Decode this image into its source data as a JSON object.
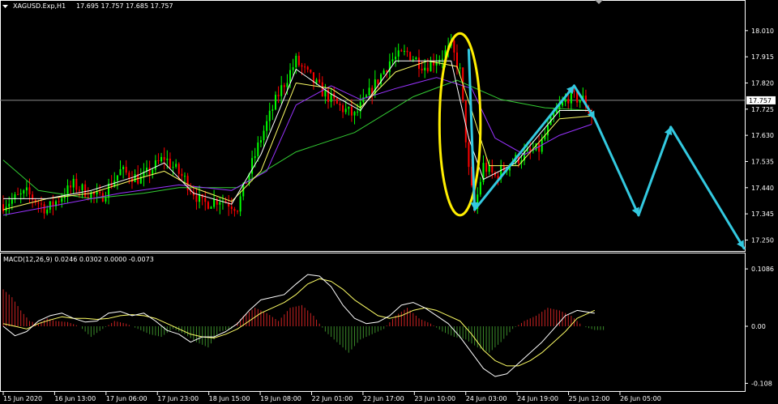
{
  "header": {
    "symbol_label": "XAGUSD.Exp,H1",
    "ohlc_label": "17.695 17.757 17.685 17.757"
  },
  "macd_header": {
    "label": "MACD(12,26,9) 0.0246 0.0302 0.0000 -0.0073"
  },
  "colors": {
    "background": "#000000",
    "bull_candle": "#00ff00",
    "bear_candle": "#ff0000",
    "ma_fast": "#ffffff",
    "ma_mid": "#ffff66",
    "ma_slow": "#9933ff",
    "ma_long": "#33cc33",
    "price_line": "#8c8c8c",
    "annotation_arrow": "#33c9e0",
    "annotation_ellipse": "#ffee00",
    "macd_positive": "#cc2222",
    "macd_negative": "#3a8a2a",
    "macd_line": "#ffffff",
    "signal_line": "#ffff66"
  },
  "chart_data": [
    {
      "type": "candlestick",
      "panel": "price",
      "title": "XAGUSD.Exp,H1",
      "y_ticks": [
        "18.010",
        "17.915",
        "17.820",
        "17.725",
        "17.630",
        "17.535",
        "17.440",
        "17.345",
        "17.250"
      ],
      "current_price_label": "17.757",
      "current_price": 17.757,
      "ylim": [
        17.222,
        18.08
      ],
      "x_tick_labels": [
        "15 Jun 2020",
        "16 Jun 13:00",
        "17 Jun 06:00",
        "17 Jun 23:00",
        "18 Jun 15:00",
        "19 Jun 08:00",
        "22 Jun 01:00",
        "22 Jun 17:00",
        "23 Jun 10:00",
        "24 Jun 03:00",
        "24 Jun 19:00",
        "25 Jun 12:00",
        "26 Jun 05:00"
      ],
      "price_path": [
        [
          0,
          17.38
        ],
        [
          8,
          17.42
        ],
        [
          15,
          17.36
        ],
        [
          24,
          17.45
        ],
        [
          33,
          17.4
        ],
        [
          40,
          17.5
        ],
        [
          47,
          17.47
        ],
        [
          55,
          17.55
        ],
        [
          62,
          17.47
        ],
        [
          68,
          17.38
        ],
        [
          74,
          17.4
        ],
        [
          80,
          17.37
        ],
        [
          88,
          17.62
        ],
        [
          94,
          17.78
        ],
        [
          100,
          17.9
        ],
        [
          108,
          17.8
        ],
        [
          114,
          17.74
        ],
        [
          120,
          17.7
        ],
        [
          125,
          17.78
        ],
        [
          132,
          17.9
        ],
        [
          138,
          17.93
        ],
        [
          144,
          17.88
        ],
        [
          150,
          17.92
        ],
        [
          153,
          17.95
        ],
        [
          156,
          17.86
        ],
        [
          159,
          17.5
        ],
        [
          161,
          17.36
        ],
        [
          164,
          17.52
        ],
        [
          168,
          17.48
        ],
        [
          173,
          17.53
        ],
        [
          178,
          17.56
        ],
        [
          183,
          17.58
        ],
        [
          188,
          17.7
        ],
        [
          193,
          17.77
        ],
        [
          198,
          17.76
        ],
        [
          201,
          17.7
        ]
      ],
      "ma_fast_path": [
        [
          0,
          17.4
        ],
        [
          15,
          17.4
        ],
        [
          30,
          17.43
        ],
        [
          45,
          17.48
        ],
        [
          55,
          17.53
        ],
        [
          65,
          17.42
        ],
        [
          78,
          17.38
        ],
        [
          88,
          17.56
        ],
        [
          100,
          17.87
        ],
        [
          112,
          17.78
        ],
        [
          122,
          17.72
        ],
        [
          134,
          17.9
        ],
        [
          145,
          17.9
        ],
        [
          153,
          17.9
        ],
        [
          159,
          17.62
        ],
        [
          164,
          17.47
        ],
        [
          175,
          17.53
        ],
        [
          190,
          17.72
        ],
        [
          201,
          17.72
        ]
      ],
      "ma_mid_path": [
        [
          0,
          17.36
        ],
        [
          15,
          17.4
        ],
        [
          30,
          17.42
        ],
        [
          45,
          17.47
        ],
        [
          55,
          17.5
        ],
        [
          65,
          17.44
        ],
        [
          78,
          17.39
        ],
        [
          88,
          17.5
        ],
        [
          100,
          17.82
        ],
        [
          112,
          17.8
        ],
        [
          122,
          17.73
        ],
        [
          134,
          17.86
        ],
        [
          145,
          17.9
        ],
        [
          155,
          17.88
        ],
        [
          160,
          17.72
        ],
        [
          166,
          17.52
        ],
        [
          176,
          17.52
        ],
        [
          190,
          17.69
        ],
        [
          201,
          17.7
        ]
      ],
      "ma_slow_path": [
        [
          0,
          17.34
        ],
        [
          20,
          17.38
        ],
        [
          40,
          17.42
        ],
        [
          60,
          17.45
        ],
        [
          78,
          17.43
        ],
        [
          90,
          17.5
        ],
        [
          100,
          17.74
        ],
        [
          112,
          17.81
        ],
        [
          122,
          17.76
        ],
        [
          134,
          17.8
        ],
        [
          148,
          17.84
        ],
        [
          160,
          17.8
        ],
        [
          168,
          17.62
        ],
        [
          178,
          17.56
        ],
        [
          190,
          17.63
        ],
        [
          201,
          17.67
        ]
      ],
      "ma_long_path": [
        [
          0,
          17.54
        ],
        [
          12,
          17.43
        ],
        [
          30,
          17.4
        ],
        [
          48,
          17.42
        ],
        [
          60,
          17.44
        ],
        [
          80,
          17.44
        ],
        [
          100,
          17.57
        ],
        [
          120,
          17.64
        ],
        [
          140,
          17.77
        ],
        [
          155,
          17.83
        ],
        [
          170,
          17.76
        ],
        [
          185,
          17.73
        ],
        [
          201,
          17.72
        ]
      ],
      "annotations": {
        "ellipse": {
          "x_center": 156,
          "y_center": 17.67,
          "x_radius": 7,
          "y_radius": 0.33
        },
        "arrows": [
          [
            [
              159,
              17.94
            ],
            [
              161,
              17.36
            ]
          ],
          [
            [
              161,
              17.36
            ],
            [
              195,
              17.81
            ]
          ],
          [
            [
              195,
              17.81
            ],
            [
              202,
              17.69
            ]
          ],
          [
            [
              202,
              17.69
            ],
            [
              217,
              17.34
            ]
          ],
          [
            [
              217,
              17.34
            ],
            [
              228,
              17.66
            ]
          ],
          [
            [
              228,
              17.66
            ],
            [
              253,
              17.22
            ]
          ]
        ]
      }
    },
    {
      "type": "macd",
      "panel": "indicator",
      "title": "MACD(12,26,9)",
      "values_label": "0.0246 0.0302 0.0000 -0.0073",
      "y_ticks": [
        "0.1086",
        "0.00",
        "-0.108"
      ],
      "ylim": [
        -0.118,
        0.118
      ],
      "histogram": [
        [
          0,
          0.07
        ],
        [
          3,
          0.055
        ],
        [
          6,
          0.03
        ],
        [
          9,
          0.01
        ],
        [
          12,
          0.005
        ],
        [
          15,
          0.015
        ],
        [
          18,
          0.01
        ],
        [
          22,
          0.008
        ],
        [
          26,
          0.0
        ],
        [
          30,
          -0.02
        ],
        [
          34,
          -0.005
        ],
        [
          38,
          0.01
        ],
        [
          42,
          0.005
        ],
        [
          46,
          -0.005
        ],
        [
          50,
          -0.015
        ],
        [
          54,
          -0.02
        ],
        [
          58,
          -0.005
        ],
        [
          62,
          -0.015
        ],
        [
          66,
          -0.03
        ],
        [
          70,
          -0.04
        ],
        [
          74,
          -0.01
        ],
        [
          78,
          -0.005
        ],
        [
          82,
          0.02
        ],
        [
          86,
          0.035
        ],
        [
          90,
          0.025
        ],
        [
          94,
          0.01
        ],
        [
          98,
          0.035
        ],
        [
          102,
          0.04
        ],
        [
          106,
          0.02
        ],
        [
          110,
          -0.01
        ],
        [
          114,
          -0.03
        ],
        [
          118,
          -0.05
        ],
        [
          122,
          -0.025
        ],
        [
          126,
          -0.015
        ],
        [
          130,
          -0.005
        ],
        [
          134,
          0.02
        ],
        [
          138,
          0.035
        ],
        [
          142,
          0.015
        ],
        [
          146,
          0.005
        ],
        [
          150,
          -0.01
        ],
        [
          154,
          -0.02
        ],
        [
          158,
          -0.025
        ],
        [
          162,
          -0.04
        ],
        [
          166,
          -0.05
        ],
        [
          170,
          -0.03
        ],
        [
          174,
          -0.005
        ],
        [
          178,
          0.01
        ],
        [
          182,
          0.02
        ],
        [
          186,
          0.035
        ],
        [
          190,
          0.03
        ],
        [
          194,
          0.02
        ],
        [
          198,
          0.0
        ],
        [
          202,
          -0.007
        ]
      ],
      "macd_line": [
        [
          0,
          0.0
        ],
        [
          4,
          -0.018
        ],
        [
          8,
          -0.01
        ],
        [
          12,
          0.01
        ],
        [
          16,
          0.02
        ],
        [
          20,
          0.025
        ],
        [
          24,
          0.015
        ],
        [
          28,
          0.008
        ],
        [
          32,
          0.01
        ],
        [
          36,
          0.025
        ],
        [
          40,
          0.028
        ],
        [
          44,
          0.02
        ],
        [
          48,
          0.025
        ],
        [
          52,
          0.01
        ],
        [
          56,
          -0.008
        ],
        [
          60,
          -0.015
        ],
        [
          64,
          -0.03
        ],
        [
          68,
          -0.02
        ],
        [
          72,
          -0.02
        ],
        [
          76,
          -0.01
        ],
        [
          80,
          0.005
        ],
        [
          84,
          0.03
        ],
        [
          88,
          0.05
        ],
        [
          92,
          0.055
        ],
        [
          96,
          0.06
        ],
        [
          100,
          0.08
        ],
        [
          104,
          0.098
        ],
        [
          108,
          0.095
        ],
        [
          112,
          0.075
        ],
        [
          116,
          0.04
        ],
        [
          120,
          0.015
        ],
        [
          124,
          0.005
        ],
        [
          128,
          0.008
        ],
        [
          132,
          0.02
        ],
        [
          136,
          0.04
        ],
        [
          140,
          0.045
        ],
        [
          144,
          0.035
        ],
        [
          148,
          0.02
        ],
        [
          152,
          0.005
        ],
        [
          156,
          -0.02
        ],
        [
          160,
          -0.05
        ],
        [
          164,
          -0.08
        ],
        [
          168,
          -0.095
        ],
        [
          172,
          -0.09
        ],
        [
          176,
          -0.07
        ],
        [
          180,
          -0.05
        ],
        [
          184,
          -0.03
        ],
        [
          188,
          -0.005
        ],
        [
          192,
          0.02
        ],
        [
          196,
          0.03
        ],
        [
          202,
          0.0246
        ]
      ],
      "signal_line": [
        [
          0,
          0.005
        ],
        [
          4,
          0.0
        ],
        [
          8,
          -0.005
        ],
        [
          12,
          0.005
        ],
        [
          16,
          0.012
        ],
        [
          20,
          0.018
        ],
        [
          24,
          0.015
        ],
        [
          28,
          0.015
        ],
        [
          32,
          0.013
        ],
        [
          36,
          0.015
        ],
        [
          40,
          0.02
        ],
        [
          44,
          0.022
        ],
        [
          48,
          0.02
        ],
        [
          52,
          0.015
        ],
        [
          56,
          0.005
        ],
        [
          60,
          -0.005
        ],
        [
          64,
          -0.015
        ],
        [
          68,
          -0.02
        ],
        [
          72,
          -0.022
        ],
        [
          76,
          -0.015
        ],
        [
          80,
          -0.005
        ],
        [
          84,
          0.01
        ],
        [
          88,
          0.025
        ],
        [
          92,
          0.035
        ],
        [
          96,
          0.045
        ],
        [
          100,
          0.06
        ],
        [
          104,
          0.08
        ],
        [
          108,
          0.09
        ],
        [
          112,
          0.085
        ],
        [
          116,
          0.07
        ],
        [
          120,
          0.05
        ],
        [
          124,
          0.035
        ],
        [
          128,
          0.02
        ],
        [
          132,
          0.015
        ],
        [
          136,
          0.02
        ],
        [
          140,
          0.03
        ],
        [
          144,
          0.035
        ],
        [
          148,
          0.03
        ],
        [
          152,
          0.02
        ],
        [
          156,
          0.01
        ],
        [
          160,
          -0.015
        ],
        [
          164,
          -0.045
        ],
        [
          168,
          -0.065
        ],
        [
          172,
          -0.075
        ],
        [
          176,
          -0.075
        ],
        [
          180,
          -0.065
        ],
        [
          184,
          -0.05
        ],
        [
          188,
          -0.03
        ],
        [
          192,
          -0.01
        ],
        [
          196,
          0.015
        ],
        [
          202,
          0.0302
        ]
      ]
    }
  ]
}
